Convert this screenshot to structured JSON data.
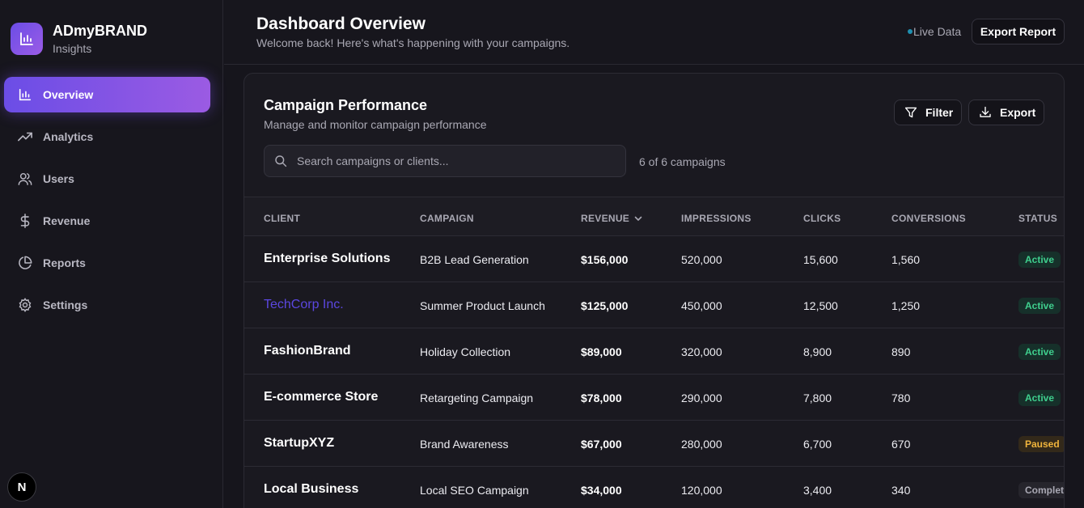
{
  "brand": {
    "name": "ADmyBRAND",
    "subtitle": "Insights"
  },
  "sidebar": {
    "items": [
      {
        "label": "Overview",
        "icon": "bar-chart-icon",
        "active": true
      },
      {
        "label": "Analytics",
        "icon": "trending-up-icon",
        "active": false
      },
      {
        "label": "Users",
        "icon": "users-icon",
        "active": false
      },
      {
        "label": "Revenue",
        "icon": "dollar-icon",
        "active": false
      },
      {
        "label": "Reports",
        "icon": "pie-chart-icon",
        "active": false
      },
      {
        "label": "Settings",
        "icon": "gear-icon",
        "active": false
      }
    ],
    "badge_letter": "N"
  },
  "header": {
    "title": "Dashboard Overview",
    "subtitle": "Welcome back! Here's what's happening with your campaigns.",
    "live_label": "Live Data",
    "export_label": "Export Report"
  },
  "card": {
    "title": "Campaign Performance",
    "subtitle": "Manage and monitor campaign performance",
    "filter_label": "Filter",
    "export_label": "Export",
    "search_placeholder": "Search campaigns or clients...",
    "count_text": "6 of 6 campaigns"
  },
  "table": {
    "headers": {
      "client": "CLIENT",
      "campaign": "CAMPAIGN",
      "revenue": "REVENUE",
      "impressions": "IMPRESSIONS",
      "clicks": "CLICKS",
      "conversions": "CONVERSIONS",
      "status": "STATUS"
    },
    "rows": [
      {
        "client": "Enterprise Solutions",
        "campaign": "B2B Lead Generation",
        "revenue": "$156,000",
        "impressions": "520,000",
        "clicks": "15,600",
        "conversions": "1,560",
        "status": "Active"
      },
      {
        "client": "TechCorp Inc.",
        "campaign": "Summer Product Launch",
        "revenue": "$125,000",
        "impressions": "450,000",
        "clicks": "12,500",
        "conversions": "1,250",
        "status": "Active"
      },
      {
        "client": "FashionBrand",
        "campaign": "Holiday Collection",
        "revenue": "$89,000",
        "impressions": "320,000",
        "clicks": "8,900",
        "conversions": "890",
        "status": "Active"
      },
      {
        "client": "E-commerce Store",
        "campaign": "Retargeting Campaign",
        "revenue": "$78,000",
        "impressions": "290,000",
        "clicks": "7,800",
        "conversions": "780",
        "status": "Active"
      },
      {
        "client": "StartupXYZ",
        "campaign": "Brand Awareness",
        "revenue": "$67,000",
        "impressions": "280,000",
        "clicks": "6,700",
        "conversions": "670",
        "status": "Paused"
      },
      {
        "client": "Local Business",
        "campaign": "Local SEO Campaign",
        "revenue": "$34,000",
        "impressions": "120,000",
        "clicks": "3,400",
        "conversions": "340",
        "status": "Completed"
      }
    ]
  },
  "colors": {
    "accent": "#7b55e6",
    "active_status": "#3fcf8e",
    "paused_status": "#f0b43c",
    "link": "#5b47e0"
  }
}
